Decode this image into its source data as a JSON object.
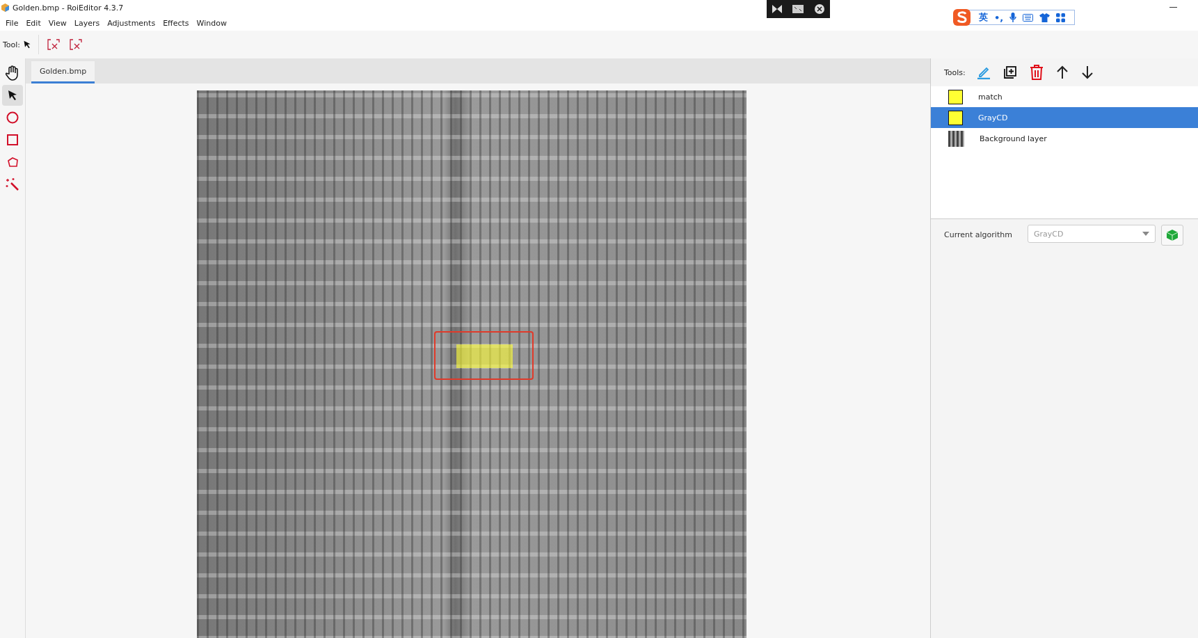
{
  "window": {
    "title": "Golden.bmp - RoiEditor 4.3.7"
  },
  "menu": [
    "File",
    "Edit",
    "View",
    "Layers",
    "Adjustments",
    "Effects",
    "Window"
  ],
  "toolbar": {
    "label": "Tool:"
  },
  "tools": [
    {
      "kind": "hand",
      "selected": false
    },
    {
      "kind": "pointer",
      "selected": true
    },
    {
      "kind": "circle",
      "selected": false
    },
    {
      "kind": "rect",
      "selected": false
    },
    {
      "kind": "polygon",
      "selected": false
    },
    {
      "kind": "wand",
      "selected": false
    }
  ],
  "tabs": [
    {
      "label": "Golden.bmp",
      "selected": true
    }
  ],
  "ime": {
    "mode": "英",
    "punct": "•,"
  },
  "layers_panel": {
    "label": "Tools:",
    "layers": [
      {
        "name": "match",
        "kind": "roi",
        "color": "#ffff33",
        "selected": false
      },
      {
        "name": "GrayCD",
        "kind": "roi",
        "color": "#ffff33",
        "selected": true
      },
      {
        "name": "Background layer",
        "kind": "image",
        "selected": false
      }
    ]
  },
  "algorithm": {
    "label": "Current algorithm",
    "value": "GrayCD",
    "disabled": true
  }
}
